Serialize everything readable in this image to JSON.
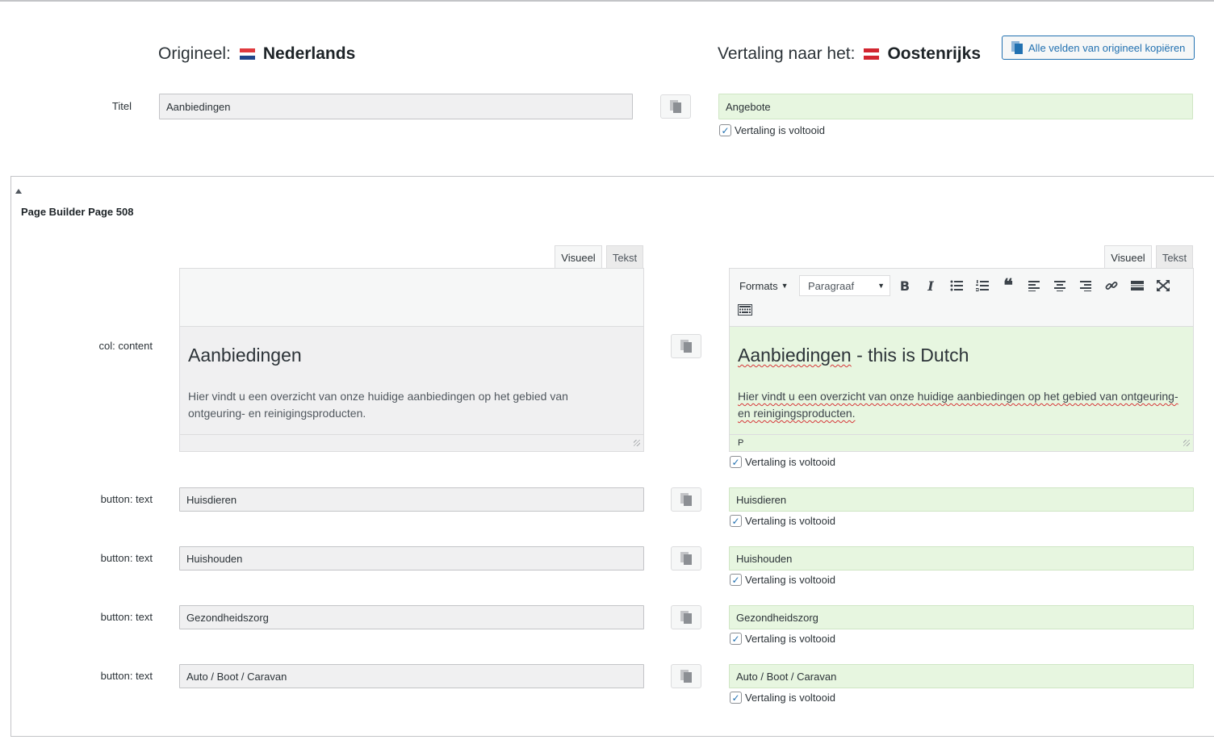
{
  "header": {
    "original_label": "Origineel:",
    "original_language": "Nederlands",
    "translation_label": "Vertaling naar het:",
    "translation_language": "Oostenrijks",
    "copy_all_button": "Alle velden van origineel kopiëren",
    "flags": {
      "nl": [
        "#e03a3e",
        "#ffffff",
        "#21468b"
      ],
      "at": [
        "#d22630",
        "#ffffff",
        "#d22630"
      ]
    }
  },
  "title_field": {
    "label": "Titel",
    "original": "Aanbiedingen",
    "translation": "Angebote",
    "complete_label": "Vertaling is voltooid"
  },
  "section": {
    "title": "Page Builder Page 508"
  },
  "content_field": {
    "label": "col: content",
    "tabs": [
      "Visueel",
      "Tekst"
    ],
    "toolbar": {
      "formats_label": "Formats",
      "block_format": "Paragraaf",
      "icons": [
        "bold-icon",
        "italic-icon",
        "bullet-list-icon",
        "numbered-list-icon",
        "blockquote-icon",
        "align-left-icon",
        "align-center-icon",
        "align-right-icon",
        "link-icon",
        "read-more-icon",
        "fullscreen-icon",
        "toolbar-toggle-icon"
      ]
    },
    "original": {
      "heading": "Aanbiedingen",
      "paragraph_line1": "Hier vindt u een overzicht van onze huidige aanbiedingen op het gebied van",
      "paragraph_line2": "ontgeuring- en reinigingsproducten."
    },
    "translation": {
      "heading_part1": "Aanbiedingen",
      "heading_part2": " - this is Dutch",
      "paragraph": "Hier vindt u een overzicht van onze huidige aanbiedingen op het gebied van ontgeuring- en reinigingsproducten.",
      "path": "P"
    },
    "complete_label": "Vertaling is voltooid"
  },
  "button_fields": [
    {
      "label": "button: text",
      "original": "Huisdieren",
      "translation": "Huisdieren",
      "complete_label": "Vertaling is voltooid"
    },
    {
      "label": "button: text",
      "original": "Huishouden",
      "translation": "Huishouden",
      "complete_label": "Vertaling is voltooid"
    },
    {
      "label": "button: text",
      "original": "Gezondheidszorg",
      "translation": "Gezondheidszorg",
      "complete_label": "Vertaling is voltooid"
    },
    {
      "label": "button: text",
      "original": "Auto / Boot / Caravan",
      "translation": "Auto / Boot / Caravan",
      "complete_label": "Vertaling is voltooid"
    }
  ],
  "checked_mark": "✓"
}
